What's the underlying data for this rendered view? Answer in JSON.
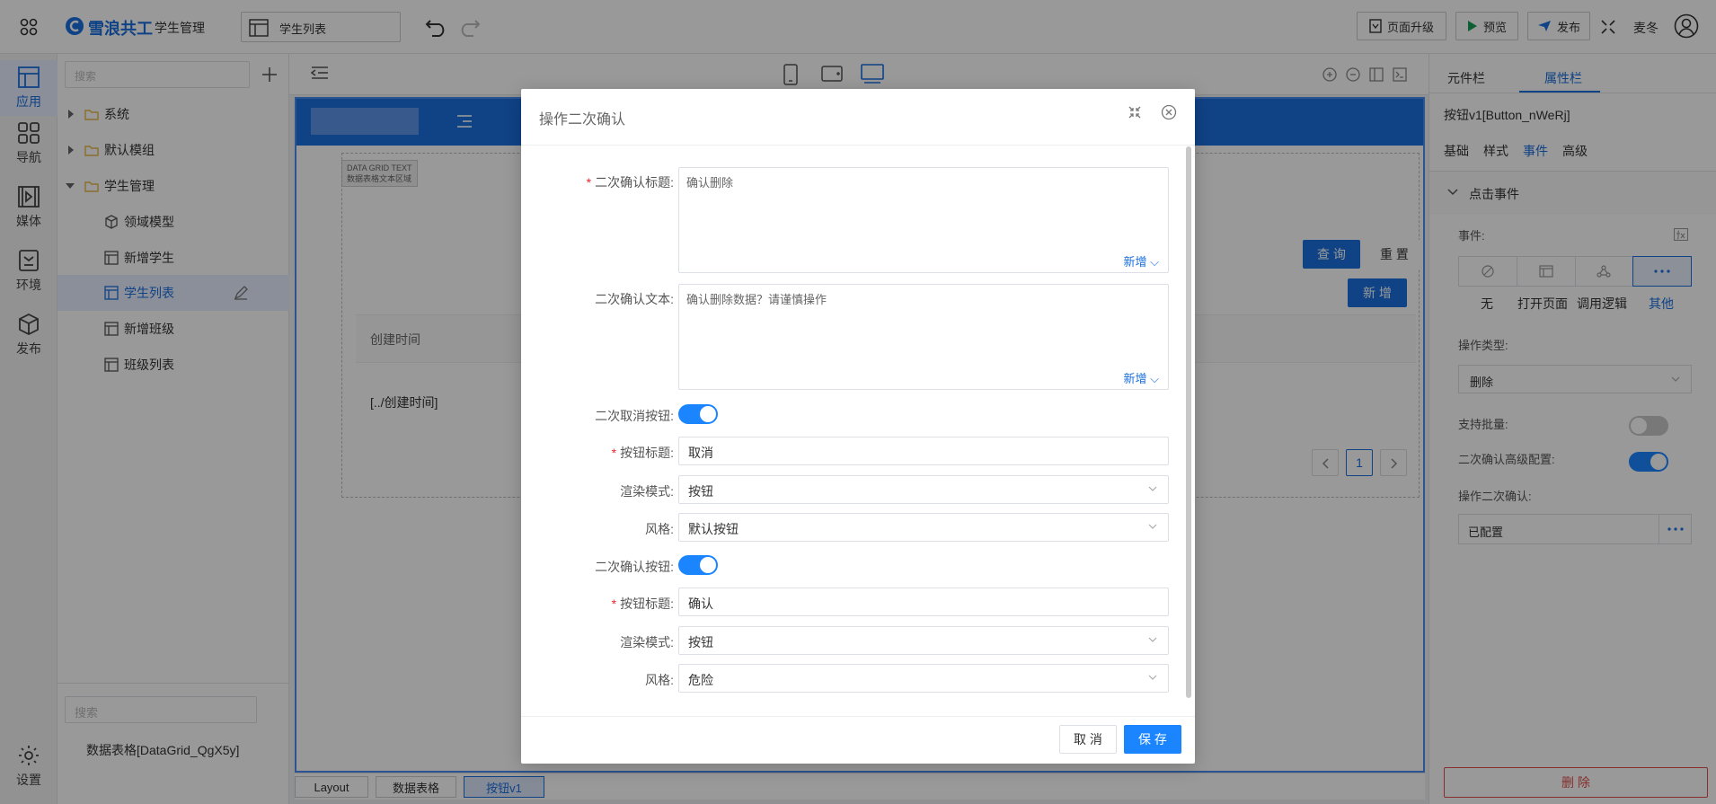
{
  "topbar": {
    "app_name": "雪浪共工",
    "module": "学生管理",
    "page_selector": "学生列表",
    "upgrade_label": "页面升级",
    "preview_label": "预览",
    "publish_label": "发布",
    "user_name": "麦冬"
  },
  "rail": {
    "items": [
      {
        "label": "应用"
      },
      {
        "label": "导航"
      },
      {
        "label": "媒体"
      },
      {
        "label": "环境"
      },
      {
        "label": "发布"
      }
    ],
    "settings_label": "设置"
  },
  "tree": {
    "search_placeholder": "搜索",
    "nodes": [
      {
        "label": "系统"
      },
      {
        "label": "默认模组"
      },
      {
        "label": "学生管理"
      },
      {
        "label": "领域模型"
      },
      {
        "label": "新增学生"
      },
      {
        "label": "学生列表"
      },
      {
        "label": "新增班级"
      },
      {
        "label": "班级列表"
      }
    ],
    "bottom_search_placeholder": "搜索",
    "outline_item": "数据表格[DataGrid_QgX5y]"
  },
  "canvas": {
    "grid_tag_line1": "DATA GRID TEXT",
    "grid_tag_line2": "数据表格文本区域",
    "query_label": "查 询",
    "reset_label": "重 置",
    "add_label": "新 增",
    "column_header": "创建时间",
    "cell_value": "[../创建时间]",
    "page_number": "1",
    "breadcrumbs": [
      "Layout",
      "数据表格",
      "按钮v1"
    ]
  },
  "props": {
    "tabs": [
      "元件栏",
      "属性栏"
    ],
    "component_title": "按钮v1[Button_nWeRj]",
    "subtabs": [
      "基础",
      "样式",
      "事件",
      "高级"
    ],
    "section_title": "点击事件",
    "event_label": "事件:",
    "event_options": [
      "无",
      "打开页面",
      "调用逻辑",
      "其他"
    ],
    "op_type_label": "操作类型:",
    "op_type_value": "删除",
    "batch_label": "支持批量:",
    "batch_enabled": false,
    "advanced_label": "二次确认高级配置:",
    "advanced_enabled": true,
    "confirm_label": "操作二次确认:",
    "confirm_value": "已配置",
    "delete_label": "删 除"
  },
  "modal": {
    "title": "操作二次确认",
    "confirm_title_label": "二次确认标题:",
    "confirm_title_value": "确认删除",
    "add_label": "新增",
    "confirm_text_label": "二次确认文本:",
    "confirm_text_value": "确认删除数据？请谨慎操作",
    "cancel_btn_label": "二次取消按钮:",
    "cancel_btn_enabled": true,
    "btn_title_label": "按钮标题:",
    "cancel_btn_title": "取消",
    "render_mode_label": "渲染模式:",
    "render_mode_value": "按钮",
    "style_label": "风格:",
    "cancel_style_value": "默认按钮",
    "confirm_btn_label": "二次确认按钮:",
    "confirm_btn_enabled": true,
    "confirm_btn_title": "确认",
    "confirm_render_value": "按钮",
    "confirm_style_value": "危险",
    "footer_cancel": "取 消",
    "footer_save": "保 存"
  },
  "colors": {
    "primary": "#1b6fe0",
    "toggle_on": "#1b84ff",
    "danger": "#e34d4d",
    "folder": "#e8b54a"
  }
}
